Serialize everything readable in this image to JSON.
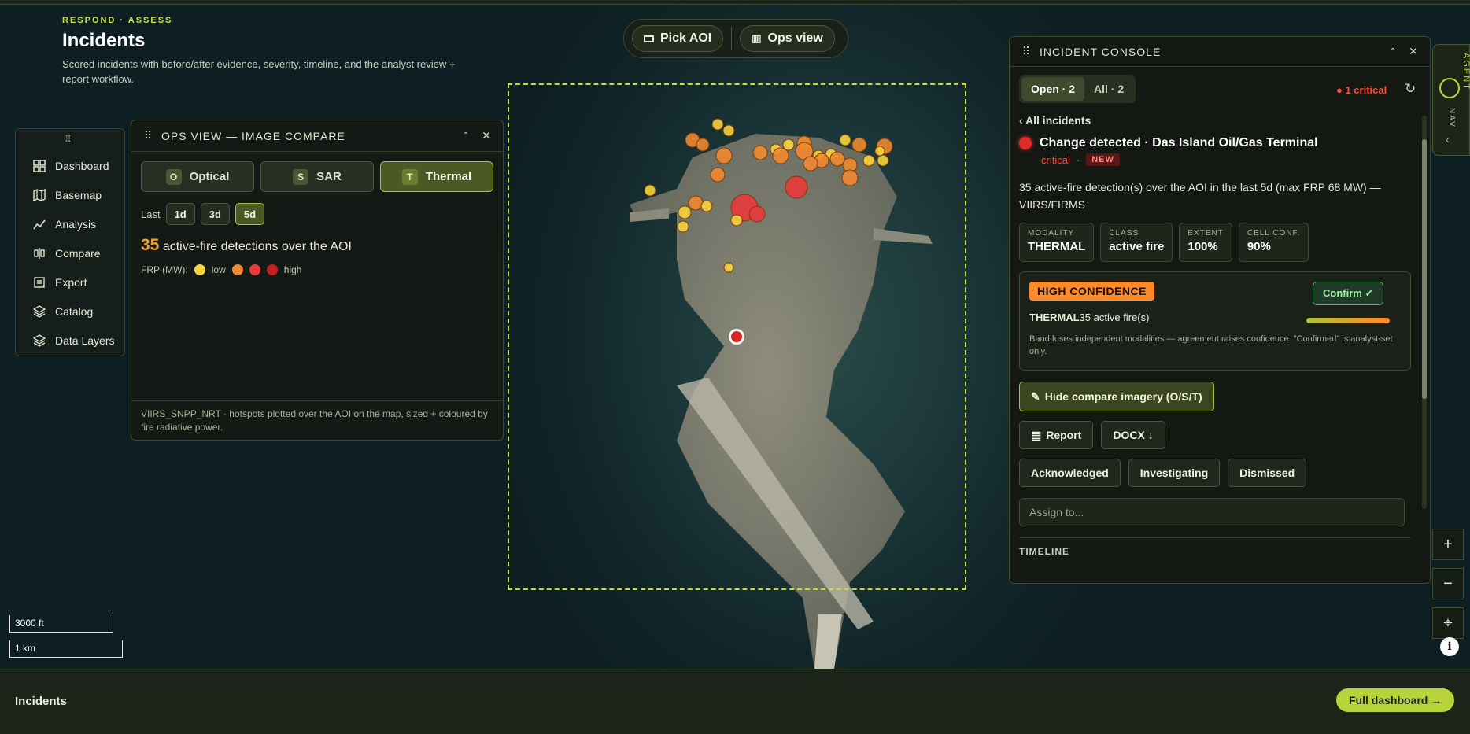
{
  "header": {
    "eyebrow": "RESPOND · ASSESS",
    "title": "Incidents",
    "subtitle": "Scored incidents with before/after evidence, severity, timeline, and the analyst review + report workflow."
  },
  "topbar": {
    "pick_aoi": "Pick AOI",
    "ops_view": "Ops view"
  },
  "nav": {
    "items": [
      {
        "label": "Dashboard",
        "icon": "dashboard-icon"
      },
      {
        "label": "Basemap",
        "icon": "map-icon"
      },
      {
        "label": "Analysis",
        "icon": "chart-icon"
      },
      {
        "label": "Compare",
        "icon": "compare-icon"
      },
      {
        "label": "Export",
        "icon": "export-icon"
      },
      {
        "label": "Catalog",
        "icon": "layers-icon"
      },
      {
        "label": "Data Layers",
        "icon": "layers-icon"
      }
    ]
  },
  "ops": {
    "title": "OPS VIEW — IMAGE COMPARE",
    "tabs": [
      {
        "key": "O",
        "label": "Optical"
      },
      {
        "key": "S",
        "label": "SAR"
      },
      {
        "key": "T",
        "label": "Thermal"
      }
    ],
    "last_label": "Last",
    "ranges": [
      "1d",
      "3d",
      "5d"
    ],
    "count": "35",
    "count_text": "active-fire detections over the AOI",
    "frp_label": "FRP (MW):",
    "frp_low": "low",
    "frp_high": "high",
    "footer": "VIIRS_SNPP_NRT · hotspots plotted over the AOI on the map, sized + coloured by fire radiative power."
  },
  "console": {
    "title": "INCIDENT CONSOLE",
    "seg_open": "Open · 2",
    "seg_all": "All · 2",
    "critical_count": "● 1 critical",
    "back": "‹ All incidents",
    "incident_title": "Change detected · Das Island Oil/Gas Terminal",
    "severity": "critical",
    "sep": "·",
    "badge": "NEW",
    "description": "35 active-fire detection(s) over the AOI in the last 5d (max FRP 68 MW) — VIIRS/FIRMS",
    "cards": [
      {
        "label": "MODALITY",
        "value": "THERMAL"
      },
      {
        "label": "CLASS",
        "value": "active fire"
      },
      {
        "label": "EXTENT",
        "value": "100%"
      },
      {
        "label": "CELL CONF.",
        "value": "90%"
      }
    ],
    "confidence": "HIGH CONFIDENCE",
    "confirm": "Confirm ✓",
    "modality_bold": "THERMAL",
    "modality_text": "35 active fire(s)",
    "note": "Band fuses independent modalities — agreement raises confidence. \"Confirmed\" is analyst-set only.",
    "hide_compare": "Hide compare imagery (O/S/T)",
    "report": "Report",
    "docx": "DOCX ↓",
    "statuses": [
      "Acknowledged",
      "Investigating",
      "Dismissed"
    ],
    "assign_placeholder": "Assign to...",
    "timeline": "TIMELINE"
  },
  "side": {
    "nav": "NAV",
    "agent": "AGENT"
  },
  "zoom": {
    "in": "+",
    "out": "−",
    "locate": "⌖"
  },
  "scale": {
    "ft": "3000 ft",
    "km": "1 km"
  },
  "info": "i",
  "ribbon": {
    "title": "Incidents",
    "full_dashboard": "Full dashboard →"
  },
  "colors": {
    "accent": "#b9d43a",
    "critical": "#ff4c3c",
    "frp": [
      "#f7d23c",
      "#f08a30",
      "#e83a3a",
      "#c41e1e"
    ]
  }
}
